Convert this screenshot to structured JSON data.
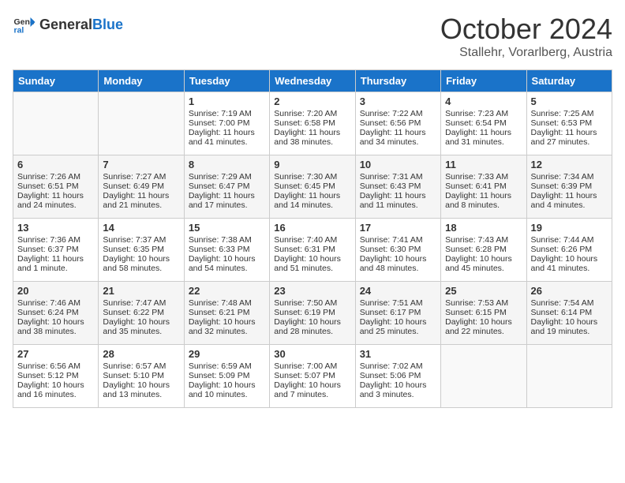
{
  "header": {
    "logo_general": "General",
    "logo_blue": "Blue",
    "month_title": "October 2024",
    "location": "Stallehr, Vorarlberg, Austria"
  },
  "days_of_week": [
    "Sunday",
    "Monday",
    "Tuesday",
    "Wednesday",
    "Thursday",
    "Friday",
    "Saturday"
  ],
  "weeks": [
    [
      {
        "day": "",
        "info": ""
      },
      {
        "day": "",
        "info": ""
      },
      {
        "day": "1",
        "info": "Sunrise: 7:19 AM\nSunset: 7:00 PM\nDaylight: 11 hours and 41 minutes."
      },
      {
        "day": "2",
        "info": "Sunrise: 7:20 AM\nSunset: 6:58 PM\nDaylight: 11 hours and 38 minutes."
      },
      {
        "day": "3",
        "info": "Sunrise: 7:22 AM\nSunset: 6:56 PM\nDaylight: 11 hours and 34 minutes."
      },
      {
        "day": "4",
        "info": "Sunrise: 7:23 AM\nSunset: 6:54 PM\nDaylight: 11 hours and 31 minutes."
      },
      {
        "day": "5",
        "info": "Sunrise: 7:25 AM\nSunset: 6:53 PM\nDaylight: 11 hours and 27 minutes."
      }
    ],
    [
      {
        "day": "6",
        "info": "Sunrise: 7:26 AM\nSunset: 6:51 PM\nDaylight: 11 hours and 24 minutes."
      },
      {
        "day": "7",
        "info": "Sunrise: 7:27 AM\nSunset: 6:49 PM\nDaylight: 11 hours and 21 minutes."
      },
      {
        "day": "8",
        "info": "Sunrise: 7:29 AM\nSunset: 6:47 PM\nDaylight: 11 hours and 17 minutes."
      },
      {
        "day": "9",
        "info": "Sunrise: 7:30 AM\nSunset: 6:45 PM\nDaylight: 11 hours and 14 minutes."
      },
      {
        "day": "10",
        "info": "Sunrise: 7:31 AM\nSunset: 6:43 PM\nDaylight: 11 hours and 11 minutes."
      },
      {
        "day": "11",
        "info": "Sunrise: 7:33 AM\nSunset: 6:41 PM\nDaylight: 11 hours and 8 minutes."
      },
      {
        "day": "12",
        "info": "Sunrise: 7:34 AM\nSunset: 6:39 PM\nDaylight: 11 hours and 4 minutes."
      }
    ],
    [
      {
        "day": "13",
        "info": "Sunrise: 7:36 AM\nSunset: 6:37 PM\nDaylight: 11 hours and 1 minute."
      },
      {
        "day": "14",
        "info": "Sunrise: 7:37 AM\nSunset: 6:35 PM\nDaylight: 10 hours and 58 minutes."
      },
      {
        "day": "15",
        "info": "Sunrise: 7:38 AM\nSunset: 6:33 PM\nDaylight: 10 hours and 54 minutes."
      },
      {
        "day": "16",
        "info": "Sunrise: 7:40 AM\nSunset: 6:31 PM\nDaylight: 10 hours and 51 minutes."
      },
      {
        "day": "17",
        "info": "Sunrise: 7:41 AM\nSunset: 6:30 PM\nDaylight: 10 hours and 48 minutes."
      },
      {
        "day": "18",
        "info": "Sunrise: 7:43 AM\nSunset: 6:28 PM\nDaylight: 10 hours and 45 minutes."
      },
      {
        "day": "19",
        "info": "Sunrise: 7:44 AM\nSunset: 6:26 PM\nDaylight: 10 hours and 41 minutes."
      }
    ],
    [
      {
        "day": "20",
        "info": "Sunrise: 7:46 AM\nSunset: 6:24 PM\nDaylight: 10 hours and 38 minutes."
      },
      {
        "day": "21",
        "info": "Sunrise: 7:47 AM\nSunset: 6:22 PM\nDaylight: 10 hours and 35 minutes."
      },
      {
        "day": "22",
        "info": "Sunrise: 7:48 AM\nSunset: 6:21 PM\nDaylight: 10 hours and 32 minutes."
      },
      {
        "day": "23",
        "info": "Sunrise: 7:50 AM\nSunset: 6:19 PM\nDaylight: 10 hours and 28 minutes."
      },
      {
        "day": "24",
        "info": "Sunrise: 7:51 AM\nSunset: 6:17 PM\nDaylight: 10 hours and 25 minutes."
      },
      {
        "day": "25",
        "info": "Sunrise: 7:53 AM\nSunset: 6:15 PM\nDaylight: 10 hours and 22 minutes."
      },
      {
        "day": "26",
        "info": "Sunrise: 7:54 AM\nSunset: 6:14 PM\nDaylight: 10 hours and 19 minutes."
      }
    ],
    [
      {
        "day": "27",
        "info": "Sunrise: 6:56 AM\nSunset: 5:12 PM\nDaylight: 10 hours and 16 minutes."
      },
      {
        "day": "28",
        "info": "Sunrise: 6:57 AM\nSunset: 5:10 PM\nDaylight: 10 hours and 13 minutes."
      },
      {
        "day": "29",
        "info": "Sunrise: 6:59 AM\nSunset: 5:09 PM\nDaylight: 10 hours and 10 minutes."
      },
      {
        "day": "30",
        "info": "Sunrise: 7:00 AM\nSunset: 5:07 PM\nDaylight: 10 hours and 7 minutes."
      },
      {
        "day": "31",
        "info": "Sunrise: 7:02 AM\nSunset: 5:06 PM\nDaylight: 10 hours and 3 minutes."
      },
      {
        "day": "",
        "info": ""
      },
      {
        "day": "",
        "info": ""
      }
    ]
  ]
}
